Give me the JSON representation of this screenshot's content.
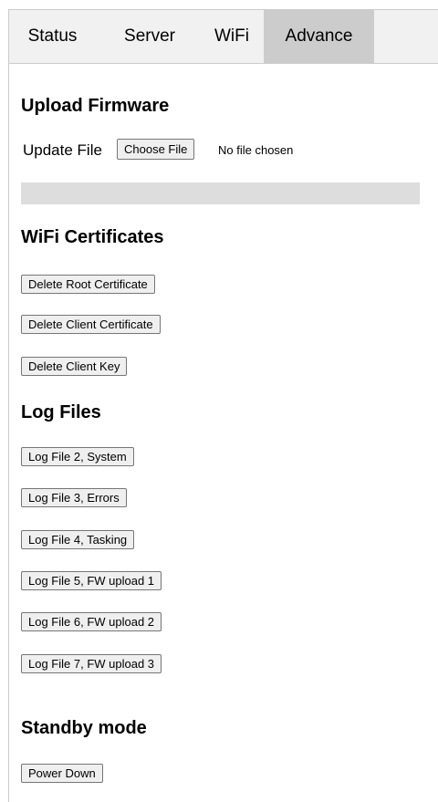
{
  "tabs": [
    {
      "label": "Status",
      "active": false
    },
    {
      "label": "Server",
      "active": false
    },
    {
      "label": "WiFi",
      "active": false
    },
    {
      "label": "Advance",
      "active": true
    }
  ],
  "upload_firmware": {
    "heading": "Upload Firmware",
    "update_file_label": "Update File",
    "choose_file_label": "Choose File",
    "file_status": "No file chosen",
    "progress": 0
  },
  "wifi_certificates": {
    "heading": "WiFi Certificates",
    "buttons": [
      "Delete Root Certificate",
      "Delete Client Certificate",
      "Delete Client Key"
    ]
  },
  "log_files": {
    "heading": "Log Files",
    "buttons": [
      "Log File 2, System",
      "Log File 3, Errors",
      "Log File 4, Tasking",
      "Log File 5, FW upload 1",
      "Log File 6, FW upload 2",
      "Log File 7, FW upload 3"
    ]
  },
  "standby": {
    "heading": "Standby mode",
    "button": "Power Down"
  }
}
